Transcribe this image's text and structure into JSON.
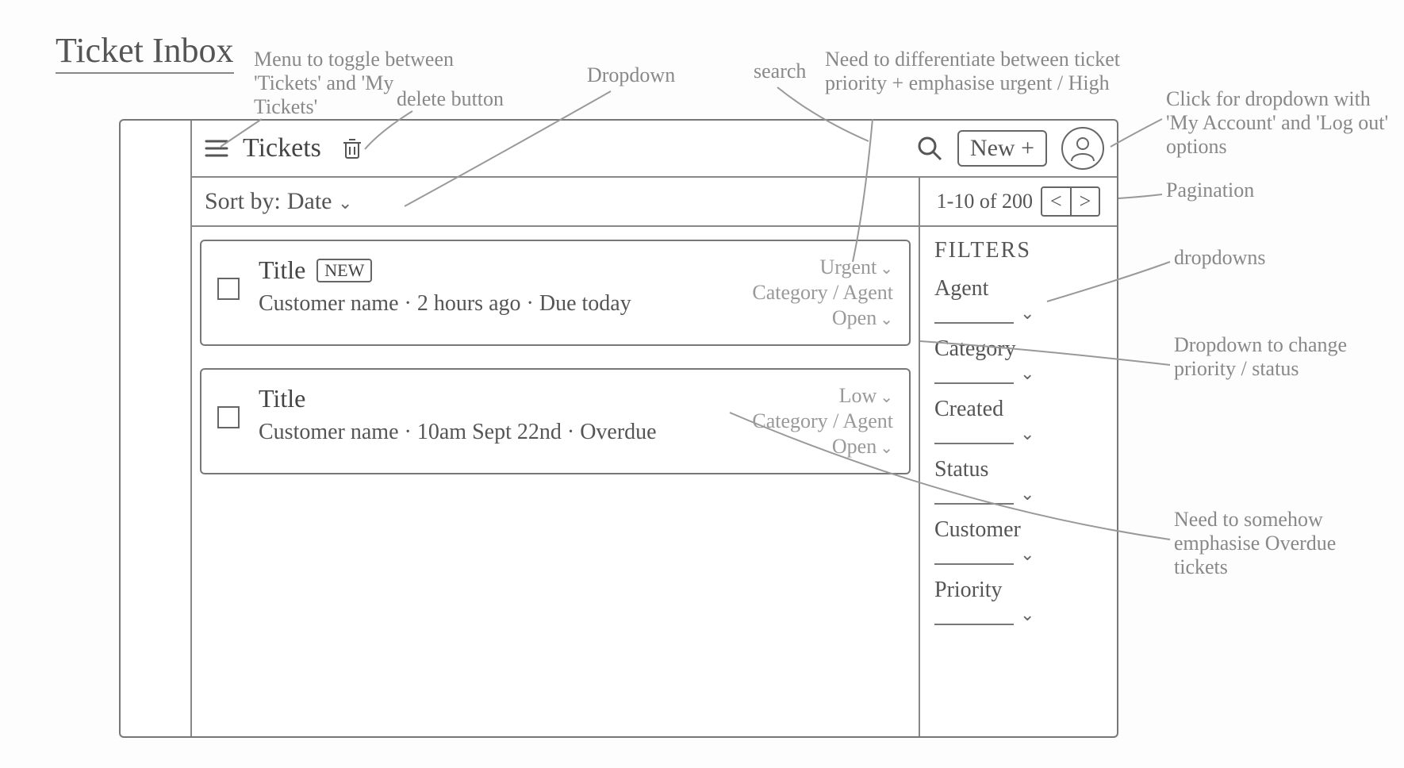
{
  "pageTitle": "Ticket Inbox",
  "header": {
    "title": "Tickets",
    "newButton": "New +"
  },
  "sortbar": {
    "label": "Sort by:",
    "value": "Date"
  },
  "pagination": {
    "range": "1-10 of 200",
    "prev": "<",
    "next": ">"
  },
  "tickets": [
    {
      "title": "Title",
      "isNew": true,
      "newBadge": "NEW",
      "customer": "Customer name",
      "time": "2 hours ago",
      "due": "Due today",
      "priority": "Urgent",
      "categoryAgent": "Category / Agent",
      "status": "Open"
    },
    {
      "title": "Title",
      "isNew": false,
      "customer": "Customer name",
      "time": "10am Sept 22nd",
      "due": "Overdue",
      "priority": "Low",
      "categoryAgent": "Category / Agent",
      "status": "Open"
    }
  ],
  "filters": {
    "title": "FILTERS",
    "items": [
      "Agent",
      "Category",
      "Created",
      "Status",
      "Customer",
      "Priority"
    ]
  },
  "annotations": {
    "menuToggle": "Menu to toggle between 'Tickets' and 'My Tickets'",
    "deleteBtn": "delete button",
    "dropdown": "Dropdown",
    "search": "search",
    "priorityEmph": "Need to differentiate between ticket priority + emphasise urgent / High",
    "avatarDropdown": "Click for dropdown with 'My Account' and 'Log out' options",
    "pagination": "Pagination",
    "dropdowns": "dropdowns",
    "changePriority": "Dropdown to change priority / status",
    "overdueEmph": "Need to somehow emphasise Overdue tickets"
  }
}
